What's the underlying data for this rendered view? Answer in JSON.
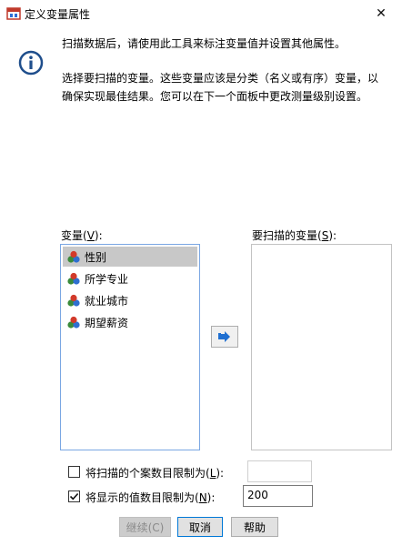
{
  "window": {
    "title": "定义变量属性",
    "close_glyph": "✕"
  },
  "message": {
    "line1": "扫描数据后，请使用此工具来标注变量值并设置其他属性。",
    "line2": "选择要扫描的变量。这些变量应该是分类（名义或有序）变量，以确保实现最佳结果。您可以在下一个面板中更改测量级别设置。"
  },
  "variables_panel": {
    "label_prefix": "变量(",
    "label_key": "V",
    "label_suffix": "):",
    "items": [
      {
        "label": "性别",
        "selected": true,
        "icon": "nominal-measure-icon"
      },
      {
        "label": "所学专业",
        "selected": false,
        "icon": "nominal-measure-icon"
      },
      {
        "label": "就业城市",
        "selected": false,
        "icon": "nominal-measure-icon"
      },
      {
        "label": "期望薪资",
        "selected": false,
        "icon": "nominal-measure-icon"
      }
    ]
  },
  "target_panel": {
    "label_prefix": "要扫描的变量(",
    "label_key": "S",
    "label_suffix": "):",
    "items": []
  },
  "options": {
    "limit_cases": {
      "label_prefix": "将扫描的个案数目限制为(",
      "label_key": "L",
      "label_suffix": "):",
      "checked": false,
      "value": ""
    },
    "limit_values": {
      "label_prefix": "将显示的值数目限制为(",
      "label_key": "N",
      "label_suffix": "):",
      "checked": true,
      "value": "200"
    }
  },
  "buttons": {
    "continue": "继续(C)",
    "cancel": "取消",
    "help": "帮助"
  },
  "colors": {
    "accent": "#0078d7",
    "list_border": "#7aa7e3",
    "arrow": "#1f6fd1"
  }
}
